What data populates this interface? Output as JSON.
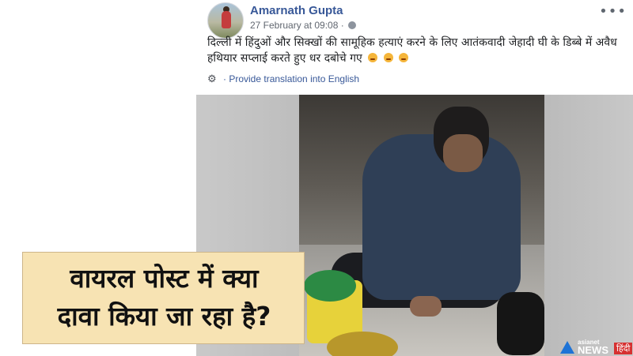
{
  "post": {
    "author_name": "Amarnath Gupta",
    "timestamp": "27 February at 09:08",
    "more_icon": "ellipsis-icon",
    "privacy_icon": "globe-icon",
    "text": "दिल्ली में हिंदुओं और सिक्खों की सामूहिक हत्याएं करने के लिए आतंकवादी जेहादी घी के डिब्बे में अवैध हथियार सप्लाई करते हुए धर दबोचे गए",
    "emoji_count": 3,
    "translate_label": "Provide translation into English"
  },
  "overlay": {
    "caption_line1": "वायरल पोस्ट में क्या",
    "caption_line2": "दावा किया जा रहा है?"
  },
  "watermark": {
    "brand_small": "asianet",
    "brand_news": "NEWS",
    "brand_hindi": "हिंदी"
  },
  "colors": {
    "link_blue": "#385898",
    "caption_bg": "#f7e3b3",
    "logo_blue": "#1e73d6",
    "logo_red": "#d63131"
  }
}
